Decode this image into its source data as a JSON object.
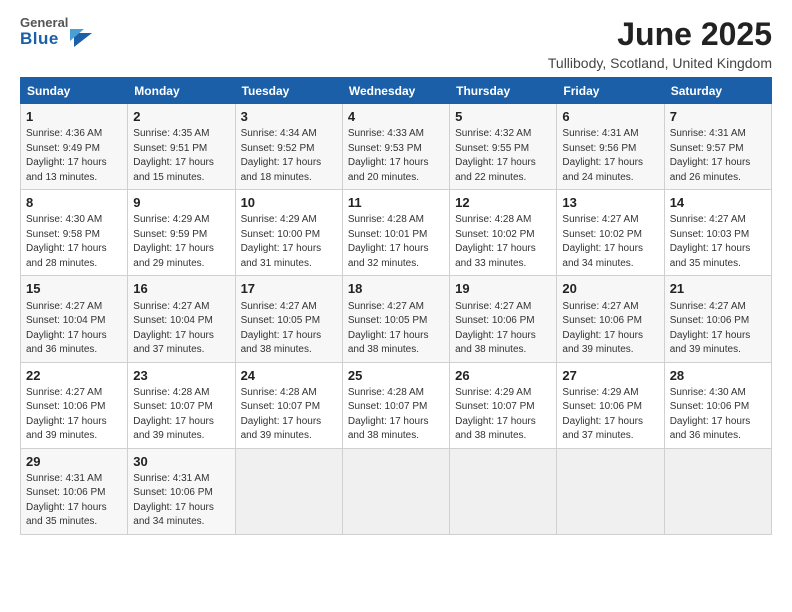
{
  "logo": {
    "general": "General",
    "blue": "Blue"
  },
  "title": "June 2025",
  "subtitle": "Tullibody, Scotland, United Kingdom",
  "days_of_week": [
    "Sunday",
    "Monday",
    "Tuesday",
    "Wednesday",
    "Thursday",
    "Friday",
    "Saturday"
  ],
  "weeks": [
    [
      {
        "day": "1",
        "info": "Sunrise: 4:36 AM\nSunset: 9:49 PM\nDaylight: 17 hours and 13 minutes."
      },
      {
        "day": "2",
        "info": "Sunrise: 4:35 AM\nSunset: 9:51 PM\nDaylight: 17 hours and 15 minutes."
      },
      {
        "day": "3",
        "info": "Sunrise: 4:34 AM\nSunset: 9:52 PM\nDaylight: 17 hours and 18 minutes."
      },
      {
        "day": "4",
        "info": "Sunrise: 4:33 AM\nSunset: 9:53 PM\nDaylight: 17 hours and 20 minutes."
      },
      {
        "day": "5",
        "info": "Sunrise: 4:32 AM\nSunset: 9:55 PM\nDaylight: 17 hours and 22 minutes."
      },
      {
        "day": "6",
        "info": "Sunrise: 4:31 AM\nSunset: 9:56 PM\nDaylight: 17 hours and 24 minutes."
      },
      {
        "day": "7",
        "info": "Sunrise: 4:31 AM\nSunset: 9:57 PM\nDaylight: 17 hours and 26 minutes."
      }
    ],
    [
      {
        "day": "8",
        "info": "Sunrise: 4:30 AM\nSunset: 9:58 PM\nDaylight: 17 hours and 28 minutes."
      },
      {
        "day": "9",
        "info": "Sunrise: 4:29 AM\nSunset: 9:59 PM\nDaylight: 17 hours and 29 minutes."
      },
      {
        "day": "10",
        "info": "Sunrise: 4:29 AM\nSunset: 10:00 PM\nDaylight: 17 hours and 31 minutes."
      },
      {
        "day": "11",
        "info": "Sunrise: 4:28 AM\nSunset: 10:01 PM\nDaylight: 17 hours and 32 minutes."
      },
      {
        "day": "12",
        "info": "Sunrise: 4:28 AM\nSunset: 10:02 PM\nDaylight: 17 hours and 33 minutes."
      },
      {
        "day": "13",
        "info": "Sunrise: 4:27 AM\nSunset: 10:02 PM\nDaylight: 17 hours and 34 minutes."
      },
      {
        "day": "14",
        "info": "Sunrise: 4:27 AM\nSunset: 10:03 PM\nDaylight: 17 hours and 35 minutes."
      }
    ],
    [
      {
        "day": "15",
        "info": "Sunrise: 4:27 AM\nSunset: 10:04 PM\nDaylight: 17 hours and 36 minutes."
      },
      {
        "day": "16",
        "info": "Sunrise: 4:27 AM\nSunset: 10:04 PM\nDaylight: 17 hours and 37 minutes."
      },
      {
        "day": "17",
        "info": "Sunrise: 4:27 AM\nSunset: 10:05 PM\nDaylight: 17 hours and 38 minutes."
      },
      {
        "day": "18",
        "info": "Sunrise: 4:27 AM\nSunset: 10:05 PM\nDaylight: 17 hours and 38 minutes."
      },
      {
        "day": "19",
        "info": "Sunrise: 4:27 AM\nSunset: 10:06 PM\nDaylight: 17 hours and 38 minutes."
      },
      {
        "day": "20",
        "info": "Sunrise: 4:27 AM\nSunset: 10:06 PM\nDaylight: 17 hours and 39 minutes."
      },
      {
        "day": "21",
        "info": "Sunrise: 4:27 AM\nSunset: 10:06 PM\nDaylight: 17 hours and 39 minutes."
      }
    ],
    [
      {
        "day": "22",
        "info": "Sunrise: 4:27 AM\nSunset: 10:06 PM\nDaylight: 17 hours and 39 minutes."
      },
      {
        "day": "23",
        "info": "Sunrise: 4:28 AM\nSunset: 10:07 PM\nDaylight: 17 hours and 39 minutes."
      },
      {
        "day": "24",
        "info": "Sunrise: 4:28 AM\nSunset: 10:07 PM\nDaylight: 17 hours and 39 minutes."
      },
      {
        "day": "25",
        "info": "Sunrise: 4:28 AM\nSunset: 10:07 PM\nDaylight: 17 hours and 38 minutes."
      },
      {
        "day": "26",
        "info": "Sunrise: 4:29 AM\nSunset: 10:07 PM\nDaylight: 17 hours and 38 minutes."
      },
      {
        "day": "27",
        "info": "Sunrise: 4:29 AM\nSunset: 10:06 PM\nDaylight: 17 hours and 37 minutes."
      },
      {
        "day": "28",
        "info": "Sunrise: 4:30 AM\nSunset: 10:06 PM\nDaylight: 17 hours and 36 minutes."
      }
    ],
    [
      {
        "day": "29",
        "info": "Sunrise: 4:31 AM\nSunset: 10:06 PM\nDaylight: 17 hours and 35 minutes."
      },
      {
        "day": "30",
        "info": "Sunrise: 4:31 AM\nSunset: 10:06 PM\nDaylight: 17 hours and 34 minutes."
      },
      {
        "day": "",
        "info": ""
      },
      {
        "day": "",
        "info": ""
      },
      {
        "day": "",
        "info": ""
      },
      {
        "day": "",
        "info": ""
      },
      {
        "day": "",
        "info": ""
      }
    ]
  ]
}
